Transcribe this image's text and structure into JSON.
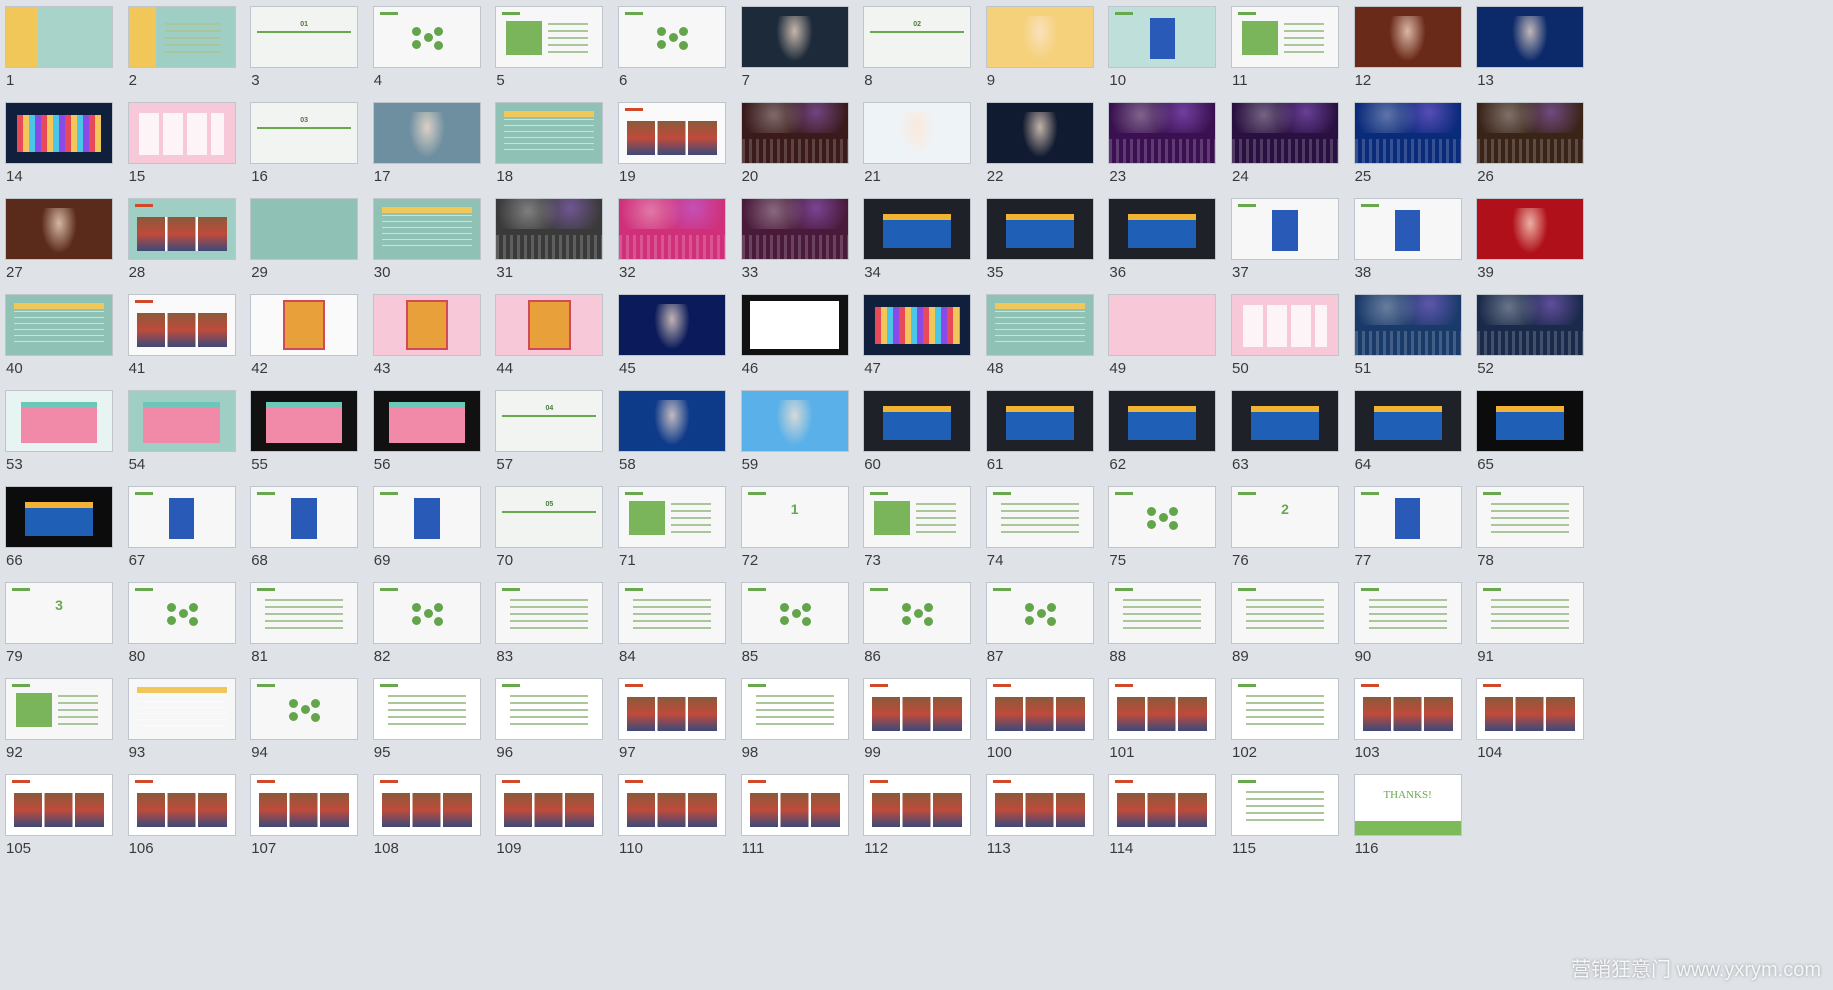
{
  "slides": [
    {
      "n": "1",
      "bg": "#a8d3c8",
      "style": "cover"
    },
    {
      "n": "2",
      "bg": "#9fcfc4",
      "style": "agenda"
    },
    {
      "n": "3",
      "bg": "#f2f4f2",
      "style": "section",
      "label": "01"
    },
    {
      "n": "4",
      "bg": "#f6f7f6",
      "style": "green-dots"
    },
    {
      "n": "5",
      "bg": "#f6f7f6",
      "style": "green-box"
    },
    {
      "n": "6",
      "bg": "#f6f7f6",
      "style": "green-dots"
    },
    {
      "n": "7",
      "bg": "#1c2a3a",
      "style": "photo"
    },
    {
      "n": "8",
      "bg": "#f2f4f2",
      "style": "section",
      "label": "02"
    },
    {
      "n": "9",
      "bg": "#f4d17a",
      "style": "photo"
    },
    {
      "n": "10",
      "bg": "#bfe0da",
      "style": "product"
    },
    {
      "n": "11",
      "bg": "#f6f7f6",
      "style": "green-box"
    },
    {
      "n": "12",
      "bg": "#6a2a1a",
      "style": "photo"
    },
    {
      "n": "13",
      "bg": "#0c2a6a",
      "style": "photo"
    },
    {
      "n": "14",
      "bg": "#10203c",
      "style": "stage"
    },
    {
      "n": "15",
      "bg": "#f6c8d8",
      "style": "pink"
    },
    {
      "n": "16",
      "bg": "#f2f4f2",
      "style": "section",
      "label": "03"
    },
    {
      "n": "17",
      "bg": "#6e8fa0",
      "style": "photo"
    },
    {
      "n": "18",
      "bg": "#8fc2b4",
      "style": "table"
    },
    {
      "n": "19",
      "bg": "#fafafa",
      "style": "photogrid"
    },
    {
      "n": "20",
      "bg": "#3a1a1a",
      "style": "crowd"
    },
    {
      "n": "21",
      "bg": "#eef3f8",
      "style": "photo"
    },
    {
      "n": "22",
      "bg": "#101a30",
      "style": "photo"
    },
    {
      "n": "23",
      "bg": "#3a1050",
      "style": "crowd"
    },
    {
      "n": "24",
      "bg": "#2a1040",
      "style": "crowd"
    },
    {
      "n": "25",
      "bg": "#0a2a7a",
      "style": "crowd"
    },
    {
      "n": "26",
      "bg": "#3a2418",
      "style": "crowd"
    },
    {
      "n": "27",
      "bg": "#5a2a1a",
      "style": "photo"
    },
    {
      "n": "28",
      "bg": "#9fcfc4",
      "style": "photogrid"
    },
    {
      "n": "29",
      "bg": "#8fc2b4",
      "style": "plain"
    },
    {
      "n": "30",
      "bg": "#8fc2b4",
      "style": "table"
    },
    {
      "n": "31",
      "bg": "#3a3a3a",
      "style": "crowd"
    },
    {
      "n": "32",
      "bg": "#d0307a",
      "style": "crowd"
    },
    {
      "n": "33",
      "bg": "#4a1a3a",
      "style": "crowd"
    },
    {
      "n": "34",
      "bg": "#1e2228",
      "style": "booth"
    },
    {
      "n": "35",
      "bg": "#1e2228",
      "style": "booth"
    },
    {
      "n": "36",
      "bg": "#1e2228",
      "style": "booth"
    },
    {
      "n": "37",
      "bg": "#f6f7f6",
      "style": "product"
    },
    {
      "n": "38",
      "bg": "#f6f7f6",
      "style": "product"
    },
    {
      "n": "39",
      "bg": "#b0101a",
      "style": "photo"
    },
    {
      "n": "40",
      "bg": "#8fc2b4",
      "style": "table"
    },
    {
      "n": "41",
      "bg": "#fafafa",
      "style": "photogrid"
    },
    {
      "n": "42",
      "bg": "#fafafa",
      "style": "poster"
    },
    {
      "n": "43",
      "bg": "#f6c8d8",
      "style": "poster"
    },
    {
      "n": "44",
      "bg": "#f6c8d8",
      "style": "poster"
    },
    {
      "n": "45",
      "bg": "#0a1a5a",
      "style": "photo"
    },
    {
      "n": "46",
      "bg": "#111111",
      "style": "screen"
    },
    {
      "n": "47",
      "bg": "#10203c",
      "style": "stage"
    },
    {
      "n": "48",
      "bg": "#8fc2b4",
      "style": "table"
    },
    {
      "n": "49",
      "bg": "#f6c8d8",
      "style": "plain"
    },
    {
      "n": "50",
      "bg": "#f6c8d8",
      "style": "pink"
    },
    {
      "n": "51",
      "bg": "#1a3a6a",
      "style": "crowd"
    },
    {
      "n": "52",
      "bg": "#1a2a4a",
      "style": "crowd"
    },
    {
      "n": "53",
      "bg": "#e8f4f2",
      "style": "booth-light"
    },
    {
      "n": "54",
      "bg": "#9fcfc4",
      "style": "booth-light"
    },
    {
      "n": "55",
      "bg": "#111111",
      "style": "booth-light"
    },
    {
      "n": "56",
      "bg": "#111111",
      "style": "booth-light"
    },
    {
      "n": "57",
      "bg": "#f2f4f2",
      "style": "section",
      "label": "04"
    },
    {
      "n": "58",
      "bg": "#0e3a8a",
      "style": "photo"
    },
    {
      "n": "59",
      "bg": "#5ab0e8",
      "style": "photo"
    },
    {
      "n": "60",
      "bg": "#1e2228",
      "style": "booth"
    },
    {
      "n": "61",
      "bg": "#1e2228",
      "style": "booth"
    },
    {
      "n": "62",
      "bg": "#1e2228",
      "style": "booth"
    },
    {
      "n": "63",
      "bg": "#1e2228",
      "style": "booth"
    },
    {
      "n": "64",
      "bg": "#1e2228",
      "style": "booth"
    },
    {
      "n": "65",
      "bg": "#0c0c0c",
      "style": "booth"
    },
    {
      "n": "66",
      "bg": "#0c0c0c",
      "style": "booth"
    },
    {
      "n": "67",
      "bg": "#f6f7f6",
      "style": "product"
    },
    {
      "n": "68",
      "bg": "#f6f7f6",
      "style": "product"
    },
    {
      "n": "69",
      "bg": "#f6f7f6",
      "style": "product"
    },
    {
      "n": "70",
      "bg": "#f2f4f2",
      "style": "section",
      "label": "05"
    },
    {
      "n": "71",
      "bg": "#f6f7f6",
      "style": "green-box"
    },
    {
      "n": "72",
      "bg": "#f6f7f6",
      "style": "number",
      "label": "1"
    },
    {
      "n": "73",
      "bg": "#f6f7f6",
      "style": "green-box"
    },
    {
      "n": "74",
      "bg": "#f6f7f6",
      "style": "lines"
    },
    {
      "n": "75",
      "bg": "#f6f7f6",
      "style": "green-dots"
    },
    {
      "n": "76",
      "bg": "#f6f7f6",
      "style": "number",
      "label": "2"
    },
    {
      "n": "77",
      "bg": "#f6f7f6",
      "style": "product"
    },
    {
      "n": "78",
      "bg": "#f6f7f6",
      "style": "lines"
    },
    {
      "n": "79",
      "bg": "#f6f7f6",
      "style": "number",
      "label": "3"
    },
    {
      "n": "80",
      "bg": "#f6f7f6",
      "style": "green-dots"
    },
    {
      "n": "81",
      "bg": "#f6f7f6",
      "style": "lines"
    },
    {
      "n": "82",
      "bg": "#f6f7f6",
      "style": "green-dots"
    },
    {
      "n": "83",
      "bg": "#f6f7f6",
      "style": "lines"
    },
    {
      "n": "84",
      "bg": "#f6f7f6",
      "style": "lines"
    },
    {
      "n": "85",
      "bg": "#f6f7f6",
      "style": "green-dots"
    },
    {
      "n": "86",
      "bg": "#f6f7f6",
      "style": "green-dots"
    },
    {
      "n": "87",
      "bg": "#f6f7f6",
      "style": "green-dots"
    },
    {
      "n": "88",
      "bg": "#f6f7f6",
      "style": "lines"
    },
    {
      "n": "89",
      "bg": "#f6f7f6",
      "style": "lines"
    },
    {
      "n": "90",
      "bg": "#f6f7f6",
      "style": "lines"
    },
    {
      "n": "91",
      "bg": "#f6f7f6",
      "style": "lines"
    },
    {
      "n": "92",
      "bg": "#f6f7f6",
      "style": "green-box"
    },
    {
      "n": "93",
      "bg": "#f6f7f6",
      "style": "table"
    },
    {
      "n": "94",
      "bg": "#f6f7f6",
      "style": "green-dots"
    },
    {
      "n": "95",
      "bg": "#ffffff",
      "style": "lines"
    },
    {
      "n": "96",
      "bg": "#ffffff",
      "style": "lines"
    },
    {
      "n": "97",
      "bg": "#ffffff",
      "style": "photogrid"
    },
    {
      "n": "98",
      "bg": "#ffffff",
      "style": "lines"
    },
    {
      "n": "99",
      "bg": "#ffffff",
      "style": "photogrid"
    },
    {
      "n": "100",
      "bg": "#ffffff",
      "style": "photogrid"
    },
    {
      "n": "101",
      "bg": "#ffffff",
      "style": "photogrid"
    },
    {
      "n": "102",
      "bg": "#ffffff",
      "style": "lines"
    },
    {
      "n": "103",
      "bg": "#ffffff",
      "style": "photogrid"
    },
    {
      "n": "104",
      "bg": "#ffffff",
      "style": "photogrid"
    },
    {
      "n": "105",
      "bg": "#ffffff",
      "style": "photogrid"
    },
    {
      "n": "106",
      "bg": "#ffffff",
      "style": "photogrid"
    },
    {
      "n": "107",
      "bg": "#ffffff",
      "style": "photogrid"
    },
    {
      "n": "108",
      "bg": "#ffffff",
      "style": "photogrid"
    },
    {
      "n": "109",
      "bg": "#ffffff",
      "style": "photogrid"
    },
    {
      "n": "110",
      "bg": "#ffffff",
      "style": "photogrid"
    },
    {
      "n": "111",
      "bg": "#ffffff",
      "style": "photogrid"
    },
    {
      "n": "112",
      "bg": "#ffffff",
      "style": "photogrid"
    },
    {
      "n": "113",
      "bg": "#ffffff",
      "style": "photogrid"
    },
    {
      "n": "114",
      "bg": "#ffffff",
      "style": "photogrid"
    },
    {
      "n": "115",
      "bg": "#ffffff",
      "style": "lines"
    },
    {
      "n": "116",
      "bg": "#ffffff",
      "style": "thanks",
      "label": "THANKS!"
    }
  ],
  "watermark": "营销狂意门 www.yxrym.com",
  "colors": {
    "accent_green": "#6aa84f",
    "background": "#dfe3e8",
    "label_text": "#3a3a3a"
  }
}
